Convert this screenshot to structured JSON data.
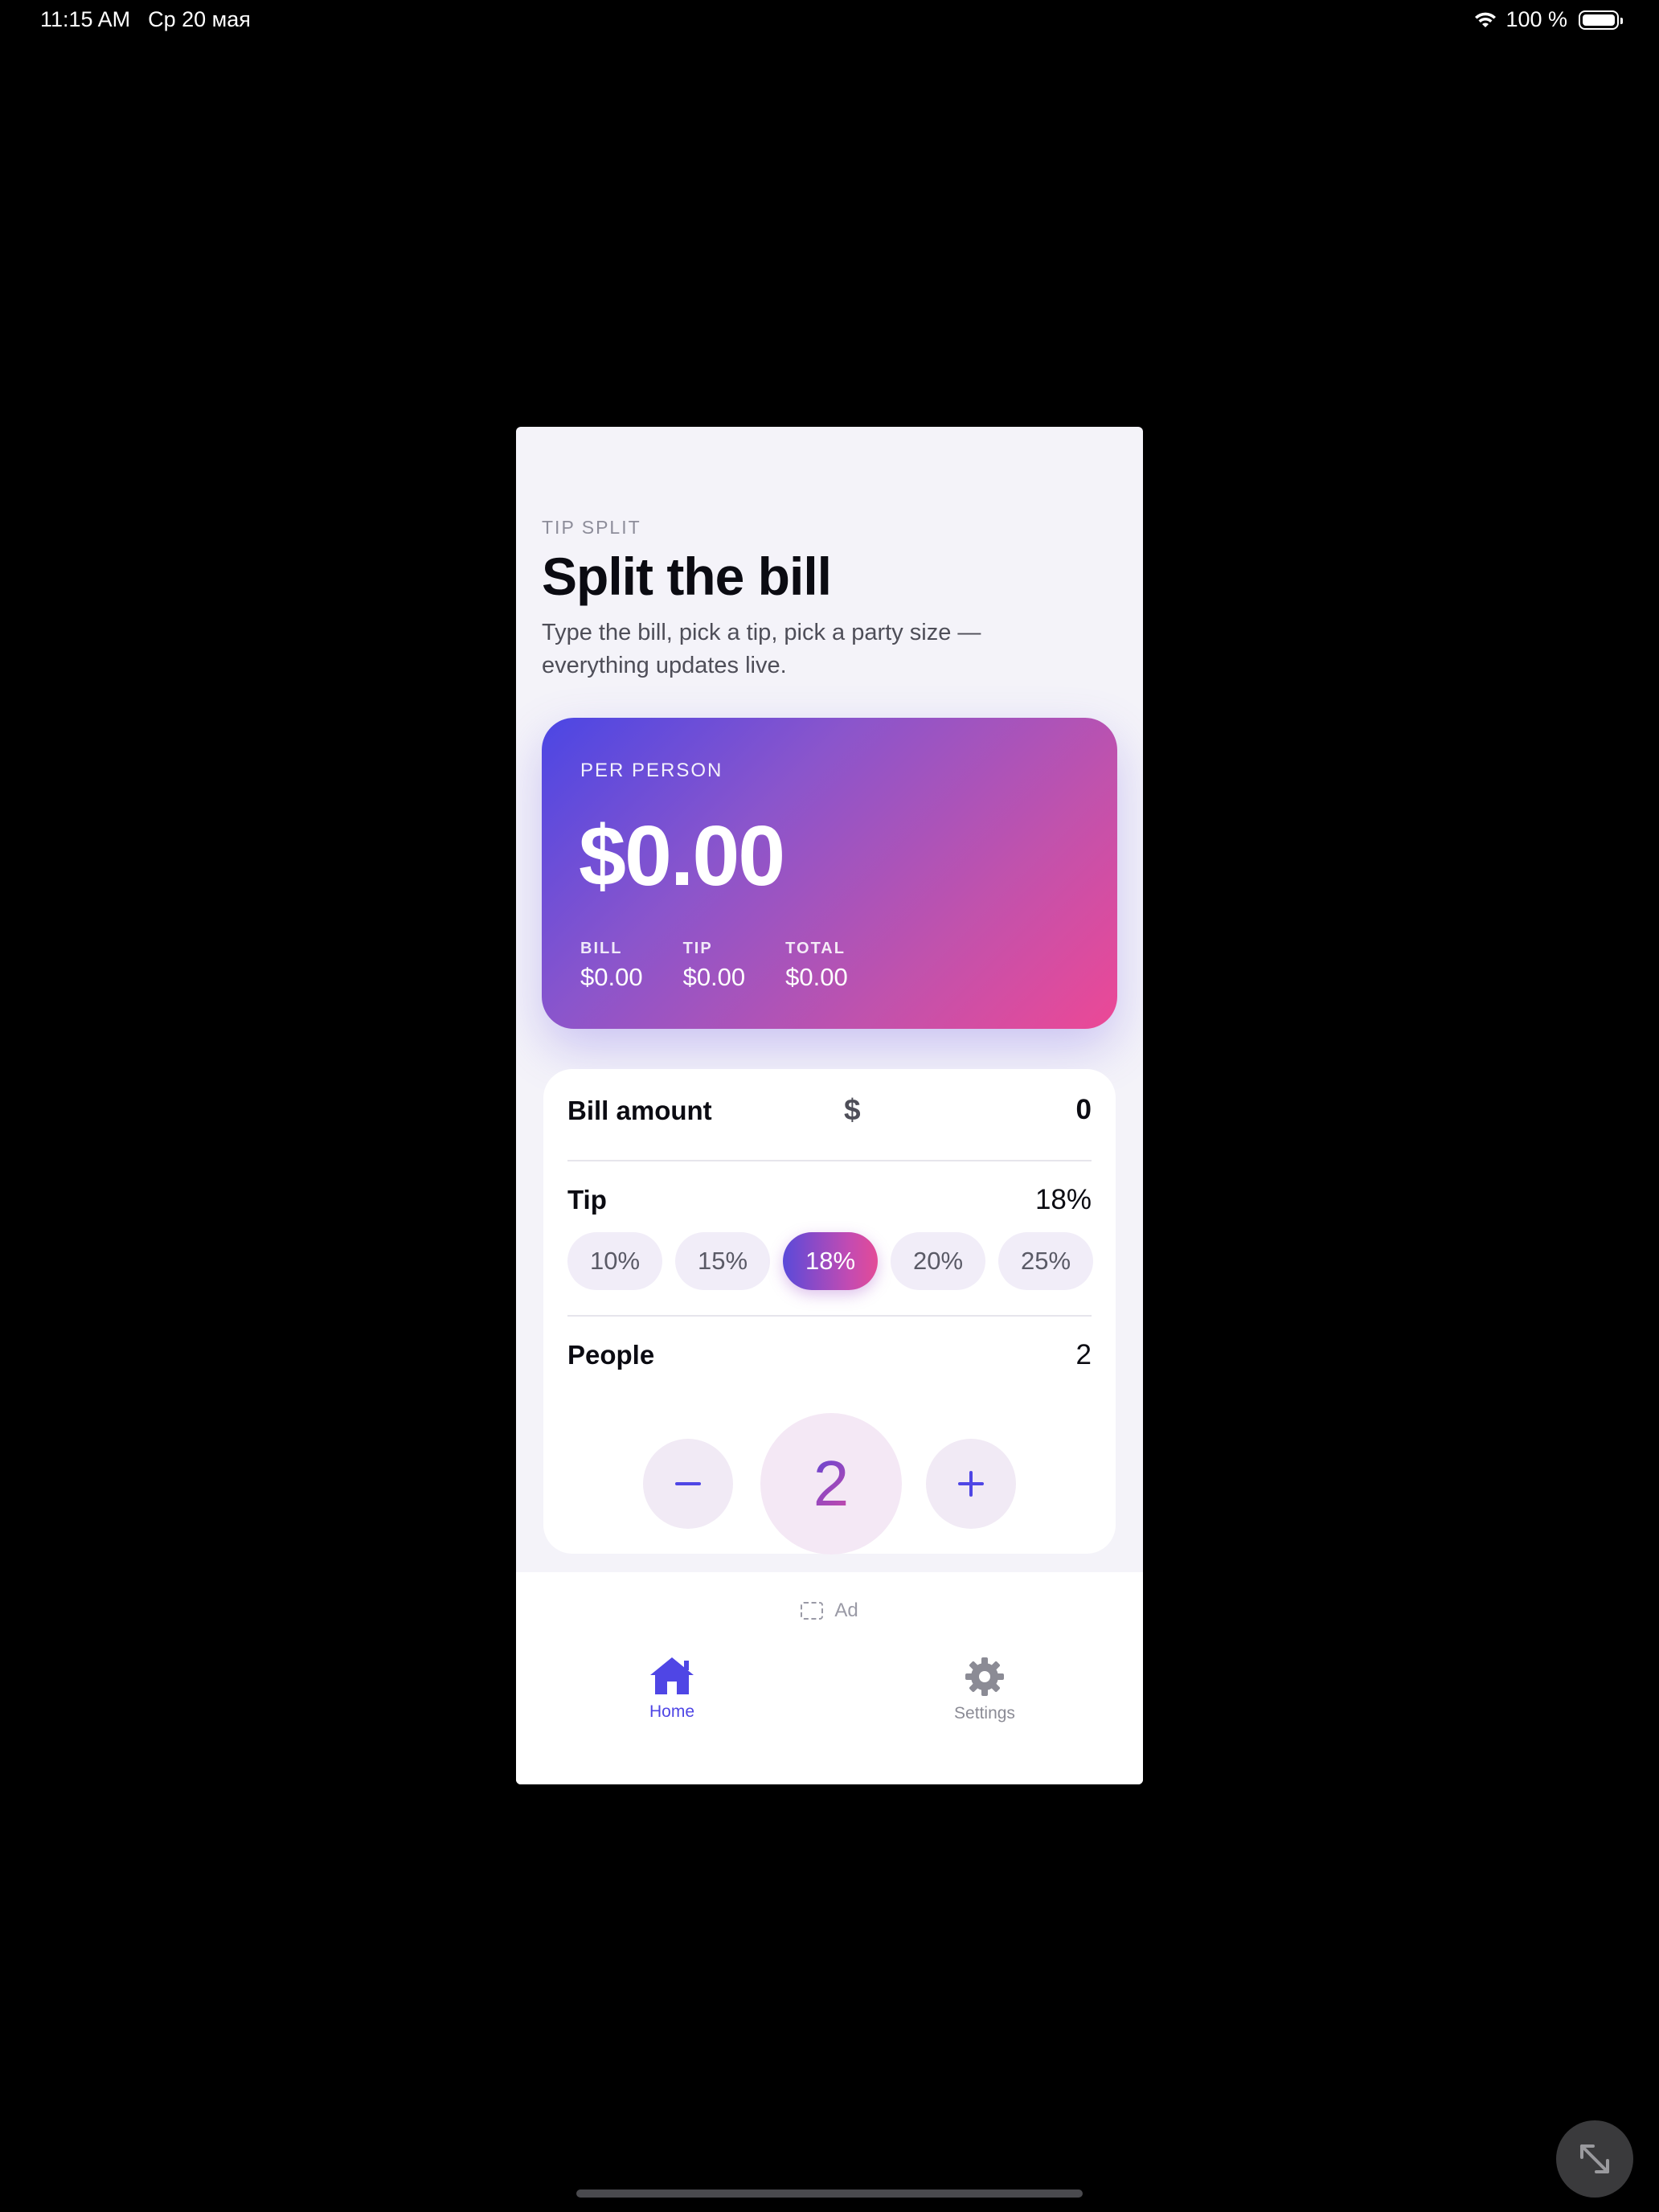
{
  "status_bar": {
    "time": "11:15 AM",
    "date": "Ср 20 мая",
    "battery": "100 %"
  },
  "header": {
    "eyebrow": "TIP SPLIT",
    "title": "Split the bill",
    "subtitle": "Type the bill, pick a tip, pick a party size — everything updates live."
  },
  "summary": {
    "label": "PER PERSON",
    "per_person": "$0.00",
    "stats": [
      {
        "label": "BILL",
        "value": "$0.00"
      },
      {
        "label": "TIP",
        "value": "$0.00"
      },
      {
        "label": "TOTAL",
        "value": "$0.00"
      }
    ]
  },
  "bill": {
    "label": "Bill amount",
    "currency": "$",
    "value": "0"
  },
  "tip": {
    "label": "Tip",
    "selected": "18%",
    "options": [
      "10%",
      "15%",
      "18%",
      "20%",
      "25%"
    ]
  },
  "people": {
    "label": "People",
    "count": "2",
    "display": "2"
  },
  "ad": {
    "label": "Ad"
  },
  "tabs": [
    {
      "label": "Home",
      "icon": "house-icon"
    },
    {
      "label": "Settings",
      "icon": "gear-icon"
    }
  ],
  "colors": {
    "accent": "#4f46e5",
    "gradient_start": "#4b46e4",
    "gradient_end": "#ec4896",
    "background": "#f4f3f9"
  }
}
